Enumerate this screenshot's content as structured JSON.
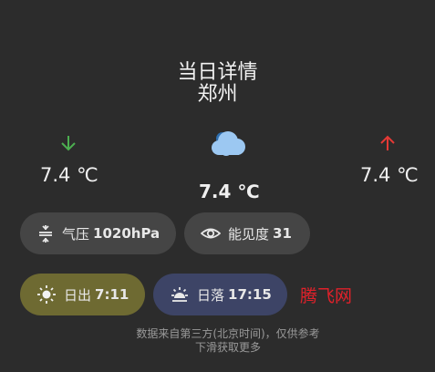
{
  "header": {
    "title": "当日详情",
    "city": "郑州"
  },
  "temperatures": {
    "low": "7.4 ℃",
    "current": "7.4 ℃",
    "high": "7.4 ℃"
  },
  "icons": {
    "low": "arrow-down-icon",
    "high": "arrow-up-icon",
    "weather": "cloud-icon",
    "pressure": "pressure-icon",
    "visibility": "eye-icon",
    "sunrise": "sunrise-icon",
    "sunset": "sunset-icon"
  },
  "colors": {
    "background": "#2c2c2c",
    "low_arrow": "#4caf50",
    "high_arrow": "#e53935",
    "cloud": "#9cc8f2",
    "chip": "#454545",
    "sunrise_chip": "#6e6a32",
    "sunset_chip": "#3d4466",
    "watermark": "#e0212a"
  },
  "details": {
    "pressure_label": "气压",
    "pressure_value": "1020hPa",
    "visibility_label": "能见度",
    "visibility_value": "31",
    "sunrise_label": "日出",
    "sunrise_value": "7:11",
    "sunset_label": "日落",
    "sunset_value": "17:15"
  },
  "watermark": "腾飞网",
  "footer": {
    "source_note": "数据来自第三方(北京时间)，仅供参考",
    "scroll_hint": "下滑获取更多"
  }
}
